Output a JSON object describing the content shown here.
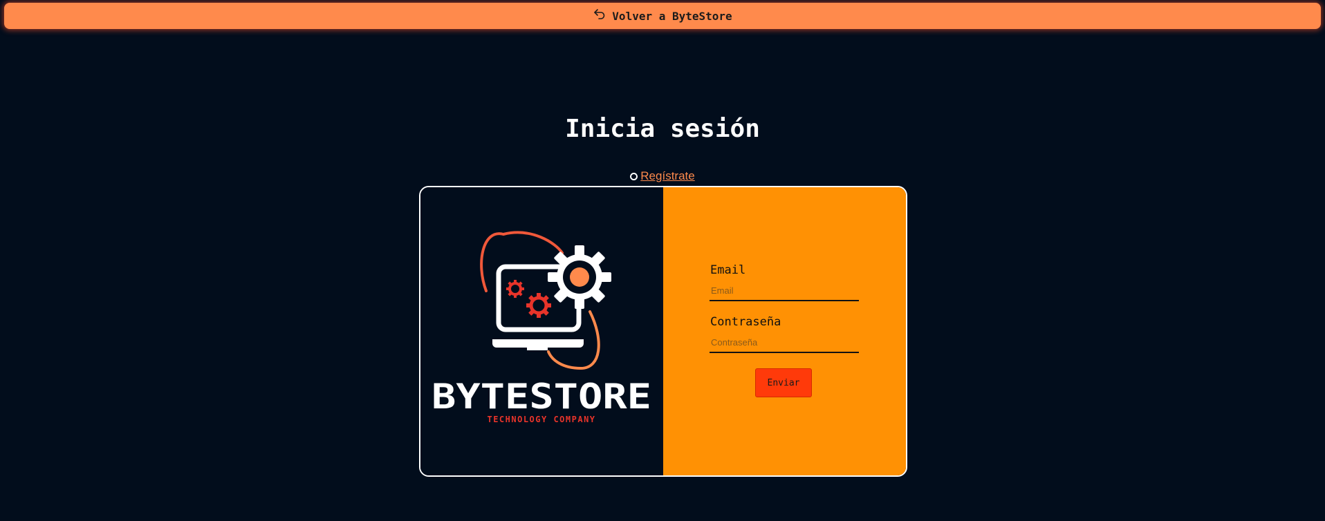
{
  "top_bar": {
    "back_label": "Volver a ByteStore",
    "icon": "undo-arrow-icon",
    "color": "#ff8a4c"
  },
  "title": "Inicia sesión",
  "register_link": "Regístrate",
  "logo": {
    "brand": "BYTESTORE",
    "tagline": "TECHNOLOGY COMPANY"
  },
  "form": {
    "email_label": "Email",
    "email_placeholder": "Email",
    "password_label": "Contraseña",
    "password_placeholder": "Contraseña",
    "submit_label": "Enviar"
  },
  "colors": {
    "background": "#020d1c",
    "accent": "#ff8a4c",
    "form_panel": "#ff9104",
    "submit": "#ff3a0a"
  }
}
